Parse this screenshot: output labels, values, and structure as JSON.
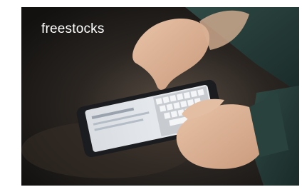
{
  "photo": {
    "watermark": "freestocks"
  }
}
